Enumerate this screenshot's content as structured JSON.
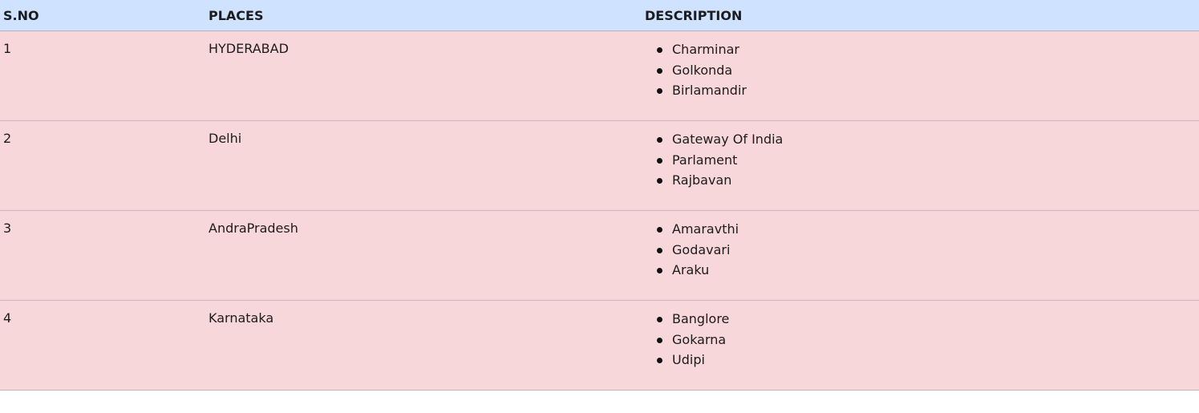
{
  "table": {
    "headers": {
      "sno": "S.NO",
      "places": "PLACES",
      "description": "DESCRIPTION"
    },
    "rows": [
      {
        "sno": "1",
        "place": "HYDERABAD",
        "items": [
          "Charminar",
          "Golkonda",
          "Birlamandir"
        ]
      },
      {
        "sno": "2",
        "place": "Delhi",
        "items": [
          "Gateway Of India",
          "Parlament",
          "Rajbavan"
        ]
      },
      {
        "sno": "3",
        "place": "AndraPradesh",
        "items": [
          "Amaravthi",
          "Godavari",
          "Araku"
        ]
      },
      {
        "sno": "4",
        "place": "Karnataka",
        "items": [
          "Banglore",
          "Gokarna",
          "Udipi"
        ]
      }
    ],
    "colors": {
      "header_bg": "#cfe2ff",
      "row_bg": "#f8d7da"
    }
  }
}
